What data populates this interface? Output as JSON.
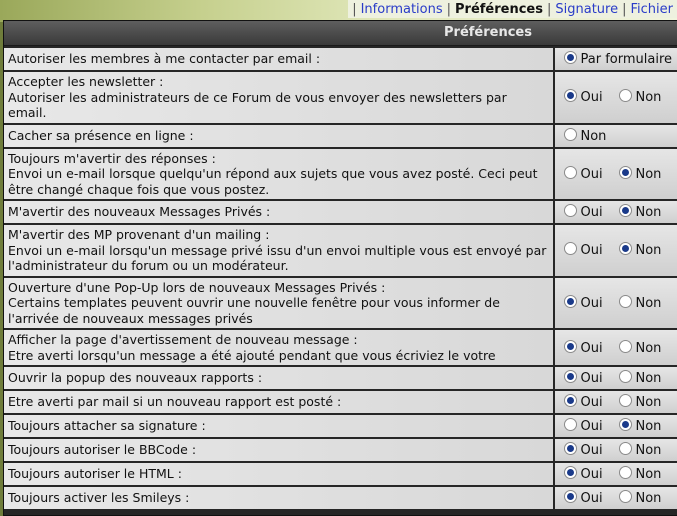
{
  "nav": {
    "tabs": [
      {
        "label": "Informations",
        "active": false
      },
      {
        "label": "Préférences",
        "active": true
      },
      {
        "label": "Signature",
        "active": false
      },
      {
        "label": "Fichier",
        "active": false
      }
    ]
  },
  "panel": {
    "title": "Préférences"
  },
  "options": {
    "oui": "Oui",
    "non": "Non",
    "par_formulaire": "Par formulaire"
  },
  "rows": [
    {
      "label": "Autoriser les membres à me contacter par email :"
    },
    {
      "label": "Accepter les newsletter :",
      "desc": "Autoriser les administrateurs de ce Forum de vous envoyer des newsletters par email."
    },
    {
      "label": "Cacher sa présence en ligne :"
    },
    {
      "label": "Toujours m'avertir des réponses :",
      "desc": "Envoi un e-mail lorsque quelqu'un répond aux sujets que vous avez posté. Ceci peut être changé chaque fois que vous postez."
    },
    {
      "label": "M'avertir des nouveaux Messages Privés :"
    },
    {
      "label": "M'avertir des MP provenant d'un mailing :",
      "desc": "Envoi un e-mail lorsqu'un message privé issu d'un envoi multiple vous est envoyé par l'administrateur du forum ou un modérateur."
    },
    {
      "label": "Ouverture d'une Pop-Up lors de nouveaux Messages Privés :",
      "desc": "Certains templates peuvent ouvrir une nouvelle fenêtre pour vous informer de l'arrivée de nouveaux messages privés"
    },
    {
      "label": "Afficher la page d'avertissement de nouveau message :",
      "desc": "Etre averti lorsqu'un message a été ajouté pendant que vous écriviez le votre"
    },
    {
      "label": "Ouvrir la popup des nouveaux rapports :"
    },
    {
      "label": "Etre averti par mail si un nouveau rapport est posté :"
    },
    {
      "label": "Toujours attacher sa signature :"
    },
    {
      "label": "Toujours autoriser le BBCode :"
    },
    {
      "label": "Toujours autoriser le HTML :"
    },
    {
      "label": "Toujours activer les Smileys :"
    }
  ],
  "selection": {
    "row0": "par_formulaire",
    "row1": "oui",
    "row2": "none",
    "row3": "non",
    "row4": "non",
    "row5": "non",
    "row6": "oui",
    "row7": "oui",
    "row8": "oui",
    "row9": "oui",
    "row10": "non",
    "row11": "oui",
    "row12": "oui",
    "row13": "oui"
  }
}
